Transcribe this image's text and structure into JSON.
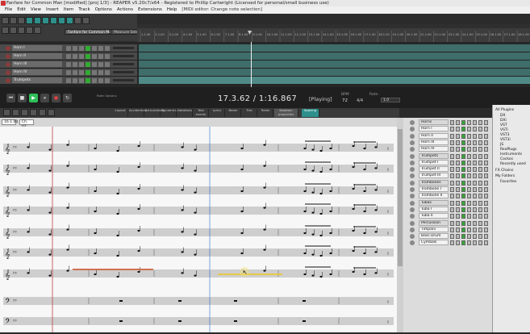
{
  "window": {
    "title": "Fanfare for Common Man [modified] [proj 1/3] - REAPER v5.20c7/x64 - Registered to Phillip Cartwright (Licensed for personal/small business use)"
  },
  "menu": {
    "items": [
      "File",
      "Edit",
      "View",
      "Insert",
      "Item",
      "Track",
      "Options",
      "Actions",
      "Extensions",
      "Help"
    ],
    "context": "[MIDI editor: Change note selection]"
  },
  "tabs": [
    "Fanfare for Common Man.rpp",
    "Measure Selection.rpp",
    "Measure Selection (Vide 2).rpp"
  ],
  "timeline": {
    "markers": [
      "1.1.00",
      "2.1.00",
      "3.1.00",
      "4.1.00",
      "5.1.00",
      "6.1.00",
      "7.1.00",
      "8.1.00",
      "9.1.00",
      "10.1.00",
      "11.1.00",
      "12.1.00",
      "13.1.00",
      "14.1.00",
      "15.1.00",
      "16.1.00",
      "17.1.00",
      "18.1.00",
      "19.1.00",
      "20.1.00",
      "21.1.00",
      "22.1.00",
      "23.1.00",
      "24.1.00",
      "25.1.00",
      "26.1.00",
      "27.1.00",
      "28.1.00"
    ]
  },
  "tracks_tcp": [
    {
      "name": "Horn I"
    },
    {
      "name": "Horn II"
    },
    {
      "name": "Horn III"
    },
    {
      "name": "Horn IV"
    },
    {
      "name": "Trumpets"
    }
  ],
  "transport": {
    "time": "17.3.62 / 1:16.867",
    "state": "[Playing]",
    "bpm_label": "BPM",
    "bpm": "72",
    "sig": "4/4",
    "rate_label": "Rate:",
    "rate": "1.0",
    "options_label": "Rate Options"
  },
  "midi_toolbar": {
    "buttons": [
      "Layout",
      "Accidentals",
      "Articulations",
      "Dynamics",
      "Notations",
      "Text events",
      "Lyrics",
      "Beam",
      "Ties",
      "Rests"
    ],
    "spacing": "Spacing",
    "editor_label": "Notation properties"
  },
  "position": {
    "pos": "16.1.00",
    "len": "Ch. 02"
  },
  "score": {
    "clef_symbols": [
      "𝄞",
      "𝄞",
      "𝄞",
      "𝄞",
      "𝄞",
      "𝄞",
      "𝄞",
      "𝄢",
      "𝄢"
    ]
  },
  "track_list": [
    {
      "name": "Horns",
      "group": true
    },
    {
      "name": "Horn I",
      "group": false
    },
    {
      "name": "Horn II",
      "group": false
    },
    {
      "name": "Horn III",
      "group": false
    },
    {
      "name": "Horn IV",
      "group": false
    },
    {
      "name": "Trumpets",
      "group": true
    },
    {
      "name": "Trumpet I",
      "group": false
    },
    {
      "name": "Trumpet II",
      "group": false
    },
    {
      "name": "Trumpet III",
      "group": false
    },
    {
      "name": "Trombones",
      "group": true
    },
    {
      "name": "Trombone I",
      "group": false
    },
    {
      "name": "Trombone II",
      "group": false
    },
    {
      "name": "Tubas",
      "group": true
    },
    {
      "name": "Tuba I",
      "group": false
    },
    {
      "name": "Tuba II",
      "group": false
    },
    {
      "name": "Percussion",
      "group": true
    },
    {
      "name": "Timpani",
      "group": false
    },
    {
      "name": "Bass Drum",
      "group": false
    },
    {
      "name": "Cymbals",
      "group": false
    }
  ],
  "plugins": {
    "root": "All Plugins",
    "items": [
      "DX",
      "DXi",
      "VST",
      "VSTi",
      "VST3",
      "VST3i",
      "JS",
      "ReaPlugs",
      "Instruments",
      "Cockos",
      "Recently used"
    ],
    "chains": "FX Chains",
    "folders": "My Folders",
    "favorites": "Favorites"
  },
  "colors": {
    "accent_teal": "#2f8f8a",
    "item_teal": "#3f6d6a",
    "playhead_blue": "#5a8ed8",
    "selection_red": "#c04040",
    "highlight_yellow": "#e6c84a"
  }
}
